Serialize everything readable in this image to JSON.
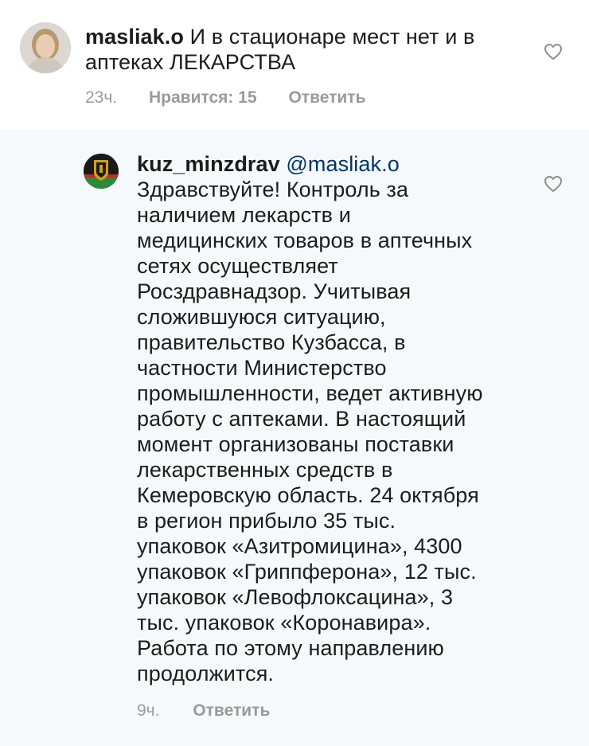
{
  "comment": {
    "username": "masliak.o",
    "text": "И в стационаре мест нет и в аптеках ЛЕКАРСТВА",
    "time": "23ч.",
    "likes": "Нравится: 15",
    "reply_label": "Ответить",
    "like_icon": "heart-outline-icon"
  },
  "reply": {
    "username": "kuz_minzdrav",
    "mention": "@masliak.o",
    "text": "Здравствуйте! Контроль за\nналичием лекарств и\nмедицинских товаров в аптечных\nсетях осуществляет\nРосздравнадзор. Учитывая\nсложившуюся ситуацию,\nправительство Кузбасса, в\nчастности Министерство\nпромышленности, ведет активную\nработу с аптеками. В настоящий\nмомент организованы поставки\nлекарственных средств в\nКемеровскую область. 24 октября\nв регион прибыло 35 тыс.\nупаковок «Азитромицина», 4300\nупаковок «Гриппферона», 12 тыс.\nупаковок «Левофлоксацина», 3\nтыс. упаковок «Коронавира».\nРабота по этому направлению\nпродолжится.",
    "time": "9ч.",
    "reply_label": "Ответить",
    "like_icon": "heart-outline-icon"
  },
  "colors": {
    "reply_background": "#f6f9fc",
    "mention": "#003569",
    "meta_gray": "#9a9a9a"
  }
}
